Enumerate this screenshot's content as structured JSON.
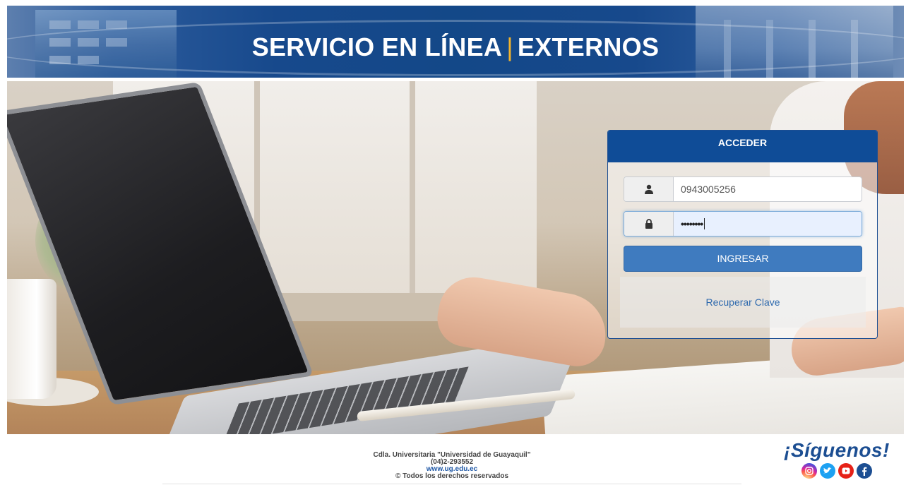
{
  "banner": {
    "title_left": "SERVICIO EN LÍNEA",
    "separator": "|",
    "title_right": "EXTERNOS"
  },
  "login": {
    "header": "ACCEDER",
    "username_value": "0943005256",
    "password_mask": "••••••••",
    "submit_label": "INGRESAR",
    "recover_label": "Recuperar Clave",
    "icons": {
      "user": "user-icon",
      "password": "lock-icon"
    }
  },
  "footer": {
    "address": "Cdla. Universitaria \"Universidad de Guayaquil\"",
    "phone": "(04)2-293552",
    "website": "www.ug.edu.ec",
    "rights": "© Todos los derechos reservados"
  },
  "social": {
    "title": "¡Síguenos!",
    "icons": [
      "instagram-icon",
      "twitter-icon",
      "youtube-icon",
      "facebook-icon"
    ]
  },
  "colors": {
    "primary": "#0f4c97",
    "button": "#3f7bbf",
    "link": "#2e6aae",
    "accent_separator": "#f2b32c"
  }
}
